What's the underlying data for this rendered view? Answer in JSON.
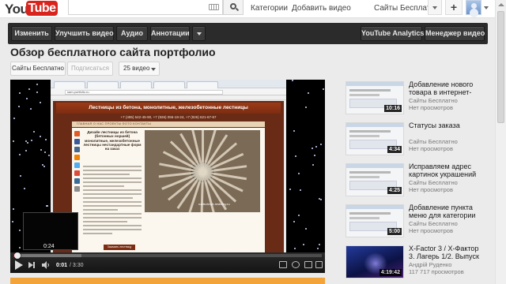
{
  "header": {
    "logo_you": "You",
    "logo_tube": "Tube",
    "nav_categories": "Категории",
    "nav_upload": "Добавить видео",
    "user_name": "Сайты Бесплатно",
    "plus_label": "+"
  },
  "owner_toolbar": {
    "edit": "Изменить",
    "enhance": "Улучшить видео",
    "audio": "Аудио",
    "annotations": "Аннотации",
    "analytics": "YouTube Analytics",
    "manager": "Менеджер видео"
  },
  "video": {
    "title": "Обзор бесплатного сайта портфолио",
    "channel": "Сайты Бесплатно",
    "subscribe": "Подписаться",
    "video_count": "25 видео"
  },
  "player": {
    "time_current": "0:01",
    "time_total": "/ 3:30",
    "preview_time": "0:24",
    "progress_played_pct": 0.5,
    "progress_loaded_pct": 22,
    "screen": {
      "url": "sam.portfolio.ru",
      "banner": "Лестницы из бетона, монолитные, железобетонные лестницы",
      "phones": "+7 (495) 542-45-90, +7 (926) 056-18-24, +7 (926) 621-67-67",
      "nav": "ГЛАВНАЯ   О НАС   ПРОЕКТЫ   ФОТО   КОНТАКТЫ",
      "heading": "Дизайн лестницы из бетона (бетонных норшей) монолитные, железобетонные лестницы нестандартные форм на заказ",
      "photo_caption": "nadezhnye-lestnitsy.ru",
      "cta": "Заказать лестницу"
    }
  },
  "sidebar": {
    "items": [
      {
        "title": "Добавление нового товара в интернет-",
        "channel": "Сайты Бесплатно",
        "views": "Нет просмотров",
        "duration": "10:16",
        "style": "light"
      },
      {
        "title": "Статусы заказа",
        "channel": "Сайты Бесплатно",
        "views": "Нет просмотров",
        "duration": "4:34",
        "style": "light"
      },
      {
        "title": "Исправляем адрес картинок украшений",
        "channel": "Сайты Бесплатно",
        "views": "Нет просмотров",
        "duration": "4:25",
        "style": "light"
      },
      {
        "title": "Добавление пункта меню для категории",
        "channel": "Сайты Бесплатно",
        "views": "Нет просмотров",
        "duration": "5:00",
        "style": "light"
      },
      {
        "title": "X-Factor 3 / Х-Фактор 3. Лагерь 1/2. Выпуск",
        "channel": "Андрій Руденко",
        "views": "117 717 просмотров",
        "duration": "4:19:42",
        "style": "dark"
      }
    ]
  },
  "colors": {
    "brand_red": "#d9231d",
    "toolbar_dark": "#2b2b2b",
    "progress_red": "#dd2222",
    "site_brown": "#6a2b16"
  }
}
